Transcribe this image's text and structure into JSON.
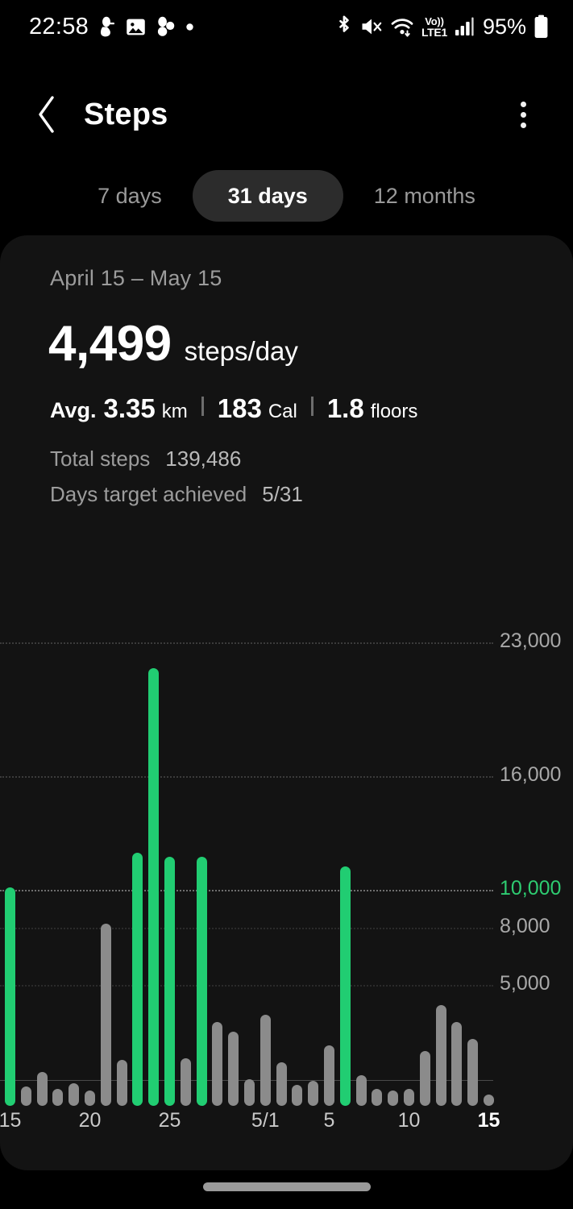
{
  "status_bar": {
    "time": "22:58",
    "battery_percent": "95%",
    "left_icons": [
      "do-not-disturb-icon",
      "image-icon",
      "samsung-cloud-icon",
      "dot-icon"
    ],
    "right_icons": [
      "bluetooth-icon",
      "mute-icon",
      "wifi-icon",
      "volte-icon",
      "signal-icon",
      "battery-icon"
    ],
    "volte_top": "Vo))",
    "volte_bottom": "LTE1"
  },
  "app_bar": {
    "back_icon": "chevron-left-icon",
    "title": "Steps",
    "more_icon": "overflow-menu-icon"
  },
  "tabs": [
    {
      "label": "7 days",
      "selected": false
    },
    {
      "label": "31 days",
      "selected": true
    },
    {
      "label": "12 months",
      "selected": false
    }
  ],
  "summary": {
    "date_range": "April 15 – May 15",
    "avg_steps": "4,499",
    "avg_steps_unit": "steps/day",
    "avg_label": "Avg.",
    "distance_value": "3.35",
    "distance_unit": "km",
    "calories_value": "183",
    "calories_unit": "Cal",
    "floors_value": "1.8",
    "floors_unit": "floors",
    "total_steps_label": "Total steps",
    "total_steps_value": "139,486",
    "days_target_label": "Days target achieved",
    "days_target_value": "5/31"
  },
  "chart_data": {
    "type": "bar",
    "title": "",
    "xlabel": "",
    "ylabel": "",
    "ylim": [
      0,
      24500
    ],
    "grid": true,
    "legend": "none",
    "target_value": 10000,
    "target_color": "#21cd72",
    "bar_color": "#8b8b8b",
    "y_ticks": [
      {
        "value": 23000,
        "label": "23,000",
        "highlight": false
      },
      {
        "value": 16000,
        "label": "16,000",
        "highlight": false
      },
      {
        "value": 10000,
        "label": "10,000",
        "highlight": true
      },
      {
        "value": 8000,
        "label": "8,000",
        "highlight": false
      },
      {
        "value": 5000,
        "label": "5,000",
        "highlight": false
      }
    ],
    "x_ticks": [
      {
        "index": 0,
        "label": "15",
        "bold": false
      },
      {
        "index": 5,
        "label": "20",
        "bold": false
      },
      {
        "index": 10,
        "label": "25",
        "bold": false
      },
      {
        "index": 16,
        "label": "5/1",
        "bold": false
      },
      {
        "index": 20,
        "label": "5",
        "bold": false
      },
      {
        "index": 25,
        "label": "10",
        "bold": false
      },
      {
        "index": 30,
        "label": "15",
        "bold": true
      }
    ],
    "categories": [
      "15",
      "16",
      "17",
      "18",
      "19",
      "20",
      "21",
      "22",
      "23",
      "24",
      "25",
      "26",
      "27",
      "28",
      "29",
      "30",
      "5/1",
      "2",
      "3",
      "4",
      "5",
      "6",
      "7",
      "8",
      "9",
      "10",
      "11",
      "12",
      "13",
      "14",
      "15"
    ],
    "values": [
      11500,
      1000,
      1800,
      900,
      1200,
      800,
      9600,
      2400,
      13300,
      23000,
      13100,
      2500,
      13100,
      4400,
      3900,
      1400,
      4800,
      2300,
      1100,
      1300,
      3200,
      12600,
      1600,
      900,
      800,
      900,
      2900,
      5300,
      4400,
      3500,
      600
    ]
  },
  "home_indicator": "home-indicator"
}
